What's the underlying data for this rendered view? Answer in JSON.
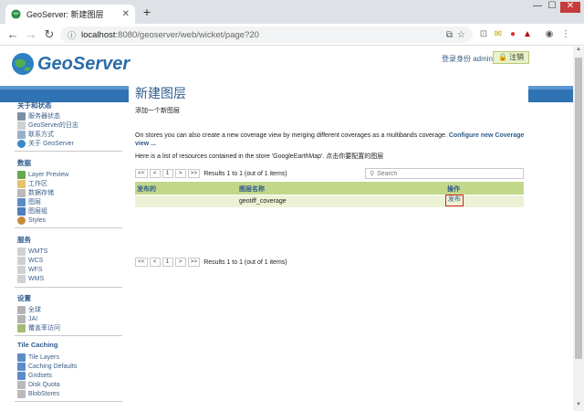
{
  "browser": {
    "tab_title": "GeoServer: 新建图层",
    "tab_close": "✕",
    "new_tab": "+",
    "url_host": "localhost",
    "url_path": ":8080/geoserver/web/wicket/page?20",
    "window_min": "—",
    "window_max": "☐",
    "window_close": "✕"
  },
  "header": {
    "logo_text": "GeoServer",
    "login_text": "登录身份 admin.",
    "logout_label": "注销"
  },
  "sidebar": {
    "sections": [
      {
        "title": "关于和状态",
        "items": [
          "服务器状态",
          "GeoServer的日志",
          "联系方式",
          "关于 GeoServer"
        ]
      },
      {
        "title": "数据",
        "items": [
          "Layer Preview",
          "工作区",
          "数据存储",
          "图层",
          "图层组",
          "Styles"
        ]
      },
      {
        "title": "服务",
        "items": [
          "WMTS",
          "WCS",
          "WFS",
          "WMS"
        ]
      },
      {
        "title": "设置",
        "items": [
          "全球",
          "JAI",
          "覆盖率访问"
        ]
      },
      {
        "title": "Tile Caching",
        "items": [
          "Tile Layers",
          "Caching Defaults",
          "Gridsets",
          "Disk Quota",
          "BlobStores"
        ]
      }
    ]
  },
  "main": {
    "title": "新建图层",
    "subtitle": "添加一个新图层",
    "para1_text": "On stores you can also create a new coverage view by merging different coverages as a multibands coverage. ",
    "para1_link": "Configure new Coverage view ...",
    "para2": "Here is a list of resources contained in the store 'GoogleEarthMap'. 点击你要配置的图层",
    "pager": {
      "first": "<<",
      "prev": "<",
      "page": "1",
      "next": ">",
      "last": ">>",
      "info": "Results 1 to 1 (out of 1 items)"
    },
    "search_placeholder": "Search",
    "table": {
      "headers": [
        "发布的",
        "图层名称",
        "操作"
      ],
      "rows": [
        {
          "published": "",
          "layer_name": "geotiff_coverage",
          "action": "发布"
        }
      ]
    }
  },
  "colors": {
    "banner": "#2f73b3",
    "link": "#2f5b8c",
    "table_header": "#c3d78a",
    "table_row": "#edf2d6",
    "highlight": "#d02424"
  }
}
